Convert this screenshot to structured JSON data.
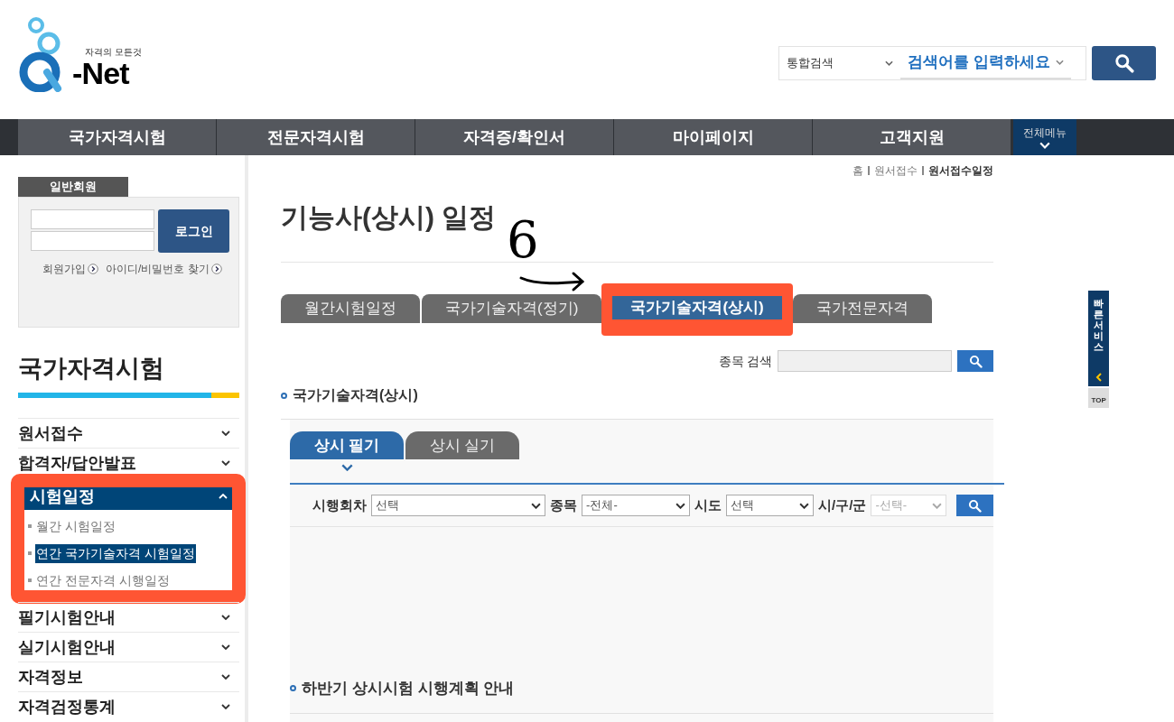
{
  "logo": {
    "tagline": "자격의 모든것",
    "name": "-Net"
  },
  "search": {
    "scope": "통합검색",
    "keyword": "검색어를 입력하세요"
  },
  "nav": {
    "items": [
      "국가자격시험",
      "전문자격시험",
      "자격증/확인서",
      "마이페이지",
      "고객지원"
    ],
    "all_menu": "전체메뉴"
  },
  "breadcrumb": [
    {
      "label": "홈",
      "current": false
    },
    {
      "label": "원서접수",
      "current": false
    },
    {
      "label": "원서접수일정",
      "current": true
    }
  ],
  "login": {
    "tab": "일반회원",
    "button": "로그인",
    "links": [
      "회원가입",
      "아이디/비밀번호 찾기"
    ]
  },
  "sidebar": {
    "title": "국가자격시험",
    "items": [
      {
        "label": "원서접수",
        "expanded": false,
        "highlighted": false
      },
      {
        "label": "합격자/답안발표",
        "expanded": false,
        "highlighted": false
      },
      {
        "label": "시험일정",
        "expanded": true,
        "highlighted": true,
        "children": [
          {
            "label": "월간 시험일정",
            "selected": false
          },
          {
            "label": "연간 국가기술자격 시험일정",
            "selected": true
          },
          {
            "label": "연간 전문자격 시행일정",
            "selected": false
          }
        ]
      },
      {
        "label": "필기시험안내",
        "expanded": false,
        "highlighted": false
      },
      {
        "label": "실기시험안내",
        "expanded": false,
        "highlighted": false
      },
      {
        "label": "자격정보",
        "expanded": false,
        "highlighted": false
      },
      {
        "label": "자격검정통계",
        "expanded": false,
        "highlighted": false
      }
    ]
  },
  "page_title": "기능사(상시) 일정",
  "annotation": {
    "mark": "6"
  },
  "tabs": [
    {
      "label": "월간시험일정",
      "selected": false,
      "highlighted": false
    },
    {
      "label": "국가기술자격(정기)",
      "selected": false,
      "highlighted": false
    },
    {
      "label": "국가기술자격(상시)",
      "selected": true,
      "highlighted": true
    },
    {
      "label": "국가전문자격",
      "selected": false,
      "highlighted": false
    }
  ],
  "item_search": {
    "label": "종목 검색"
  },
  "section_title": "국가기술자격(상시)",
  "subtabs": [
    {
      "label": "상시 필기",
      "selected": true
    },
    {
      "label": "상시 실기",
      "selected": false
    }
  ],
  "filters": [
    {
      "label": "시행회차",
      "value": "선택",
      "disabled": false
    },
    {
      "label": "종목",
      "value": "-전체-",
      "disabled": false
    },
    {
      "label": "시도",
      "value": "선택",
      "disabled": false
    },
    {
      "label": "시/구/군",
      "value": "-선택-",
      "disabled": true
    }
  ],
  "plan_title": "하반기 상시시험 시행계획 안내",
  "quick_bar": {
    "label": "빠른서비스",
    "top": "TOP"
  }
}
